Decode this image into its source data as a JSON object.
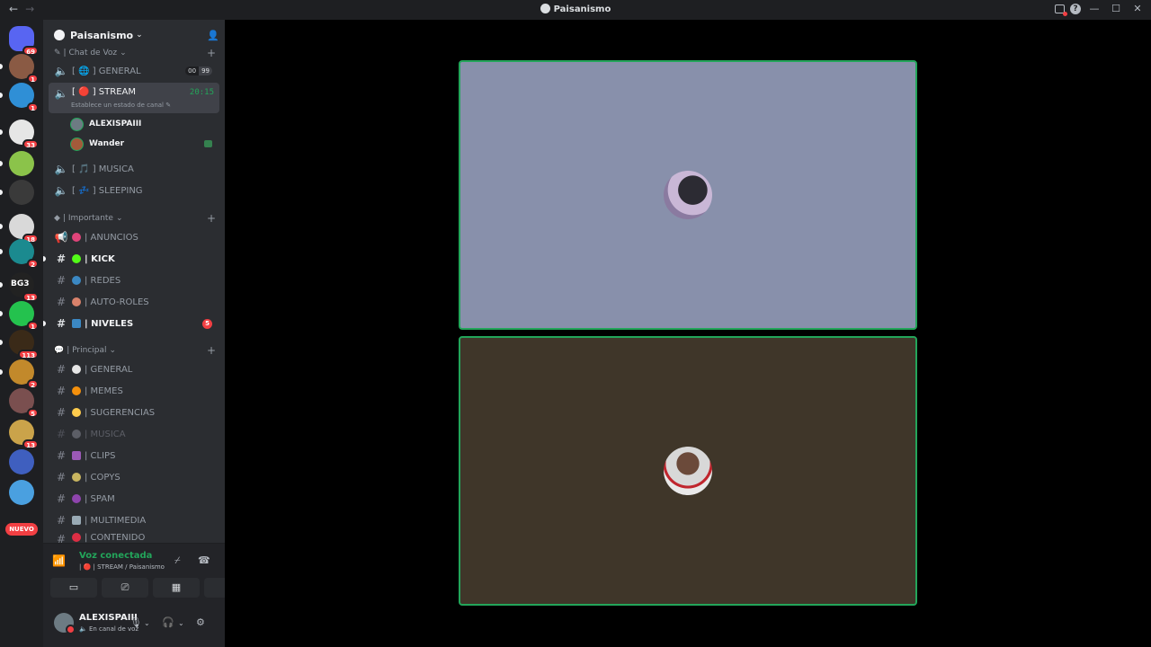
{
  "window": {
    "title": "Paisanismo",
    "back": "←",
    "forward": "→",
    "minimize": "—",
    "maximize": "☐",
    "close": "✕",
    "help": "?"
  },
  "rail": {
    "servers": [
      {
        "badge": "69",
        "color": "#5865f2"
      },
      {
        "badge": "1",
        "color": "#8a5a44"
      },
      {
        "badge": "1",
        "color": "#2f8fd6"
      },
      {
        "badge": "33",
        "color": "#e6e6e6"
      },
      {
        "badge": "",
        "color": "#8bc34a"
      },
      {
        "badge": "",
        "color": "#3a3a3a"
      },
      {
        "badge": "18",
        "color": "#d9d9d9"
      },
      {
        "badge": "2",
        "color": "#1b8a8f"
      },
      {
        "badge": "13",
        "color": "#222222",
        "text": "BG3"
      },
      {
        "badge": "1",
        "color": "#24c24e"
      },
      {
        "badge": "113",
        "color": "#3a2a18"
      },
      {
        "badge": "2",
        "color": "#c2892b"
      },
      {
        "badge": "5",
        "color": "#7a4f4f"
      },
      {
        "badge": "13",
        "color": "#caa34a"
      },
      {
        "badge": "",
        "color": "#3f5fbf"
      },
      {
        "badge": "",
        "color": "#4aa0e0"
      }
    ],
    "new_label": "NUEVO"
  },
  "guild": {
    "name": "Paisanismo"
  },
  "categories": {
    "voice": "| Chat de Voz",
    "important": "| Importante",
    "main": "| Principal"
  },
  "channels": {
    "general_voice": {
      "name": "[ 🌐 ] GENERAL",
      "users_a": "00",
      "users_b": "99"
    },
    "stream": {
      "name": "[ 🔴 ] STREAM",
      "time": "20:15",
      "sub": "Establece un estado de canal ✎"
    },
    "voice_users": [
      "ALEXISPAIII",
      "Wander"
    ],
    "musica_voice": "[ 🎵 ] MUSICA",
    "sleeping": "[ 💤 ] SLEEPING",
    "anuncios": "| ANUNCIOS",
    "kick": "| KICK",
    "redes": "| REDES",
    "auto_roles": "| AUTO-ROLES",
    "niveles": "| NIVELES",
    "niveles_badge": "5",
    "general": "| GENERAL",
    "memes": "| MEMES",
    "sugerencias": "| SUGERENCIAS",
    "musica": "| MUSICA",
    "clips": "| CLIPS",
    "copys": "| COPYS",
    "spam": "| SPAM",
    "multimedia": "| MULTIMEDIA",
    "contenido": "| CONTENIDO"
  },
  "voice_panel": {
    "status": "Voz conectada",
    "channel": "| 🔴 | STREAM / Paisanismo"
  },
  "user_panel": {
    "name": "ALEXISPAIII",
    "status": "🔈 En canal de voz"
  },
  "tiles": [
    {
      "bg": "#8890ab"
    },
    {
      "bg": "#3f3629"
    }
  ],
  "colors": {
    "accent_green": "#23a55a",
    "danger": "#f23f43"
  }
}
